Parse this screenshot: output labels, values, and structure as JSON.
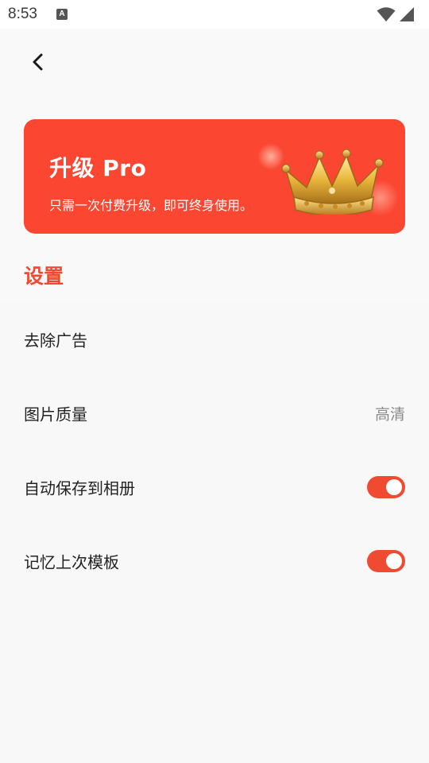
{
  "status_bar": {
    "time": "8:53",
    "notification_icon": "A"
  },
  "header": {
    "back_icon": "chevron-left-icon"
  },
  "pro_banner": {
    "title": "升级 Pro",
    "subtitle": "只需一次付费升级，即可终身使用。",
    "icon": "crown-icon",
    "background_color": "#fb4632"
  },
  "settings": {
    "section_title": "设置",
    "accent_color": "#f04a33",
    "items": [
      {
        "label": "去除广告",
        "type": "link"
      },
      {
        "label": "图片质量",
        "type": "value",
        "value": "高清"
      },
      {
        "label": "自动保存到相册",
        "type": "toggle",
        "on": true
      },
      {
        "label": "记忆上次模板",
        "type": "toggle",
        "on": true
      }
    ]
  }
}
